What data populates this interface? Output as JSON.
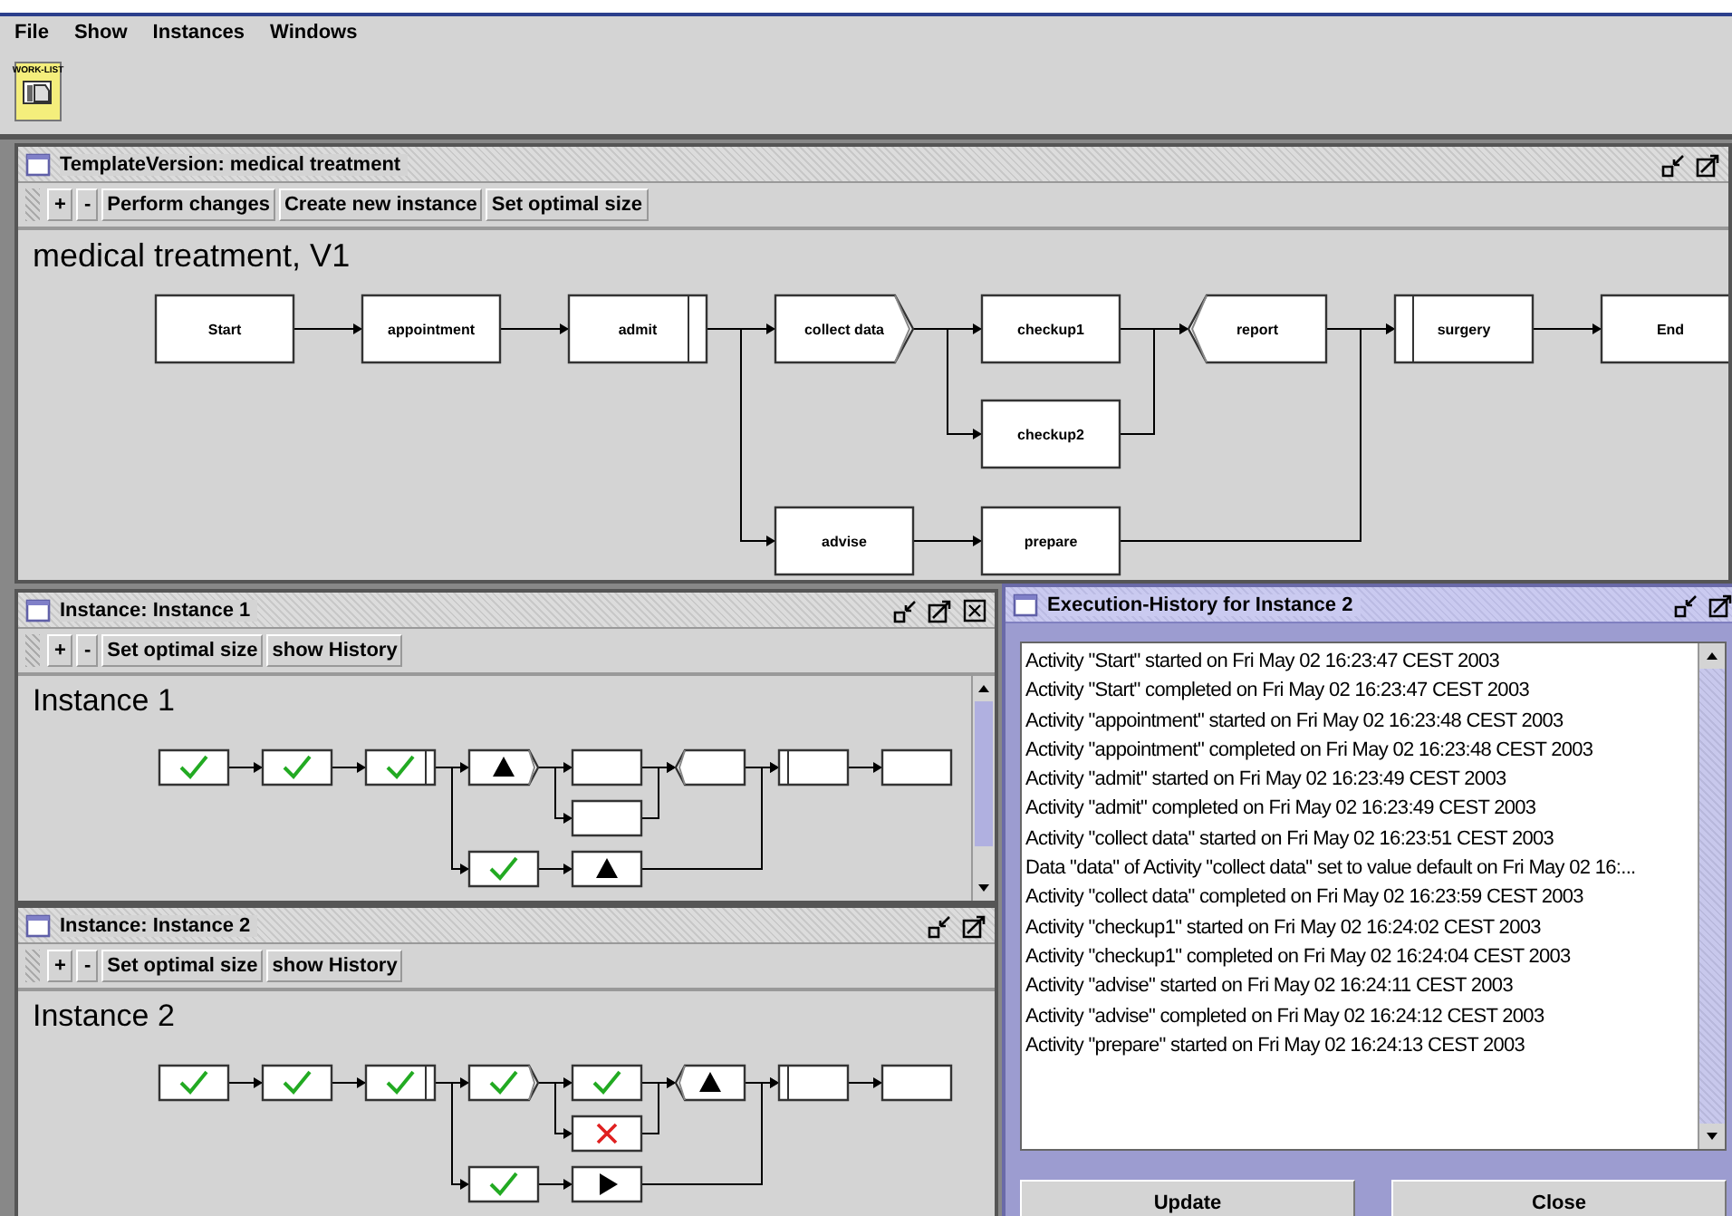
{
  "menu": [
    {
      "label": "File"
    },
    {
      "label": "Show"
    },
    {
      "label": "Instances"
    },
    {
      "label": "Windows"
    }
  ],
  "toolbar": {
    "worklist_button": {
      "label": "WORK-LIST"
    }
  },
  "template_window": {
    "title": "TemplateVersion: medical treatment",
    "active": false,
    "buttons": [
      "+",
      "-",
      "Perform changes",
      "Create new instance",
      "Set optimal size"
    ],
    "heading": "medical treatment, V1",
    "nodes": [
      {
        "label": "Start",
        "kind": "task"
      },
      {
        "label": "appointment",
        "kind": "task"
      },
      {
        "label": "admit",
        "kind": "xorsplit"
      },
      {
        "label": "collect data",
        "kind": "andsplit"
      },
      {
        "label": "checkup1",
        "kind": "task"
      },
      {
        "label": "checkup2",
        "kind": "task"
      },
      {
        "label": "report",
        "kind": "andjoin"
      },
      {
        "label": "advise",
        "kind": "task"
      },
      {
        "label": "prepare",
        "kind": "task"
      },
      {
        "label": "surgery",
        "kind": "xorjoin"
      },
      {
        "label": "End",
        "kind": "task"
      }
    ]
  },
  "instance_windows": [
    {
      "title": "Instance: Instance 1",
      "active": false,
      "closable": true,
      "scrollbar": true,
      "buttons": [
        "+",
        "-",
        "Set optimal size",
        "show History"
      ],
      "heading": "Instance 1",
      "nodes": [
        {
          "kind": "task",
          "completed": true,
          "activated": false,
          "running": false,
          "skipped": false
        },
        {
          "kind": "task",
          "completed": true,
          "activated": false,
          "running": false,
          "skipped": false
        },
        {
          "kind": "xorsplit",
          "completed": true,
          "activated": false,
          "running": false,
          "skipped": false
        },
        {
          "kind": "andsplit",
          "completed": false,
          "activated": true,
          "running": false,
          "skipped": false
        },
        {
          "kind": "task",
          "completed": false,
          "activated": false,
          "running": false,
          "skipped": false
        },
        {
          "kind": "task",
          "completed": false,
          "activated": false,
          "running": false,
          "skipped": false
        },
        {
          "kind": "andjoin",
          "completed": false,
          "activated": false,
          "running": false,
          "skipped": false
        },
        {
          "kind": "task",
          "completed": true,
          "activated": false,
          "running": false,
          "skipped": false
        },
        {
          "kind": "task",
          "completed": false,
          "activated": true,
          "running": false,
          "skipped": false
        },
        {
          "kind": "xorjoin",
          "completed": false,
          "activated": false,
          "running": false,
          "skipped": false
        },
        {
          "kind": "task",
          "completed": false,
          "activated": false,
          "running": false,
          "skipped": false
        }
      ]
    },
    {
      "title": "Instance: Instance 2",
      "active": false,
      "closable": false,
      "scrollbar": false,
      "buttons": [
        "+",
        "-",
        "Set optimal size",
        "show History"
      ],
      "heading": "Instance 2",
      "nodes": [
        {
          "kind": "task",
          "completed": true,
          "activated": false,
          "running": false,
          "skipped": false
        },
        {
          "kind": "task",
          "completed": true,
          "activated": false,
          "running": false,
          "skipped": false
        },
        {
          "kind": "xorsplit",
          "completed": true,
          "activated": false,
          "running": false,
          "skipped": false
        },
        {
          "kind": "andsplit",
          "completed": true,
          "activated": false,
          "running": false,
          "skipped": false
        },
        {
          "kind": "task",
          "completed": true,
          "activated": false,
          "running": false,
          "skipped": false
        },
        {
          "kind": "task",
          "completed": false,
          "activated": false,
          "running": false,
          "skipped": true
        },
        {
          "kind": "andjoin",
          "completed": false,
          "activated": true,
          "running": false,
          "skipped": false
        },
        {
          "kind": "task",
          "completed": true,
          "activated": false,
          "running": false,
          "skipped": false
        },
        {
          "kind": "task",
          "completed": false,
          "activated": false,
          "running": true,
          "skipped": false
        },
        {
          "kind": "xorjoin",
          "completed": false,
          "activated": false,
          "running": false,
          "skipped": false
        },
        {
          "kind": "task",
          "completed": false,
          "activated": false,
          "running": false,
          "skipped": false
        }
      ]
    }
  ],
  "history_window": {
    "title": "Execution-History for Instance 2",
    "active": true,
    "entries": [
      "Activity \"Start\" started on Fri May 02 16:23:47 CEST 2003",
      "Activity \"Start\" completed on Fri May 02 16:23:47 CEST 2003",
      "Activity \"appointment\" started on Fri May 02 16:23:48 CEST 2003",
      "Activity \"appointment\" completed on Fri May 02 16:23:48 CEST 2003",
      "Activity \"admit\" started on Fri May 02 16:23:49 CEST 2003",
      "Activity \"admit\" completed on Fri May 02 16:23:49 CEST 2003",
      "Activity \"collect data\" started on Fri May 02 16:23:51 CEST 2003",
      "Data \"data\" of Activity \"collect data\" set to value default on Fri May 02 16:...",
      "Activity \"collect data\" completed on Fri May 02 16:23:59 CEST 2003",
      "Activity \"checkup1\" started on Fri May 02 16:24:02 CEST 2003",
      "Activity \"checkup1\" completed on Fri May 02 16:24:04 CEST 2003",
      "Activity \"advise\" started on Fri May 02 16:24:11 CEST 2003",
      "Activity \"advise\" completed on Fri May 02 16:24:12 CEST 2003",
      "Activity \"prepare\" started on Fri May 02 16:24:13 CEST 2003"
    ],
    "buttons": [
      "Update",
      "Close"
    ]
  }
}
